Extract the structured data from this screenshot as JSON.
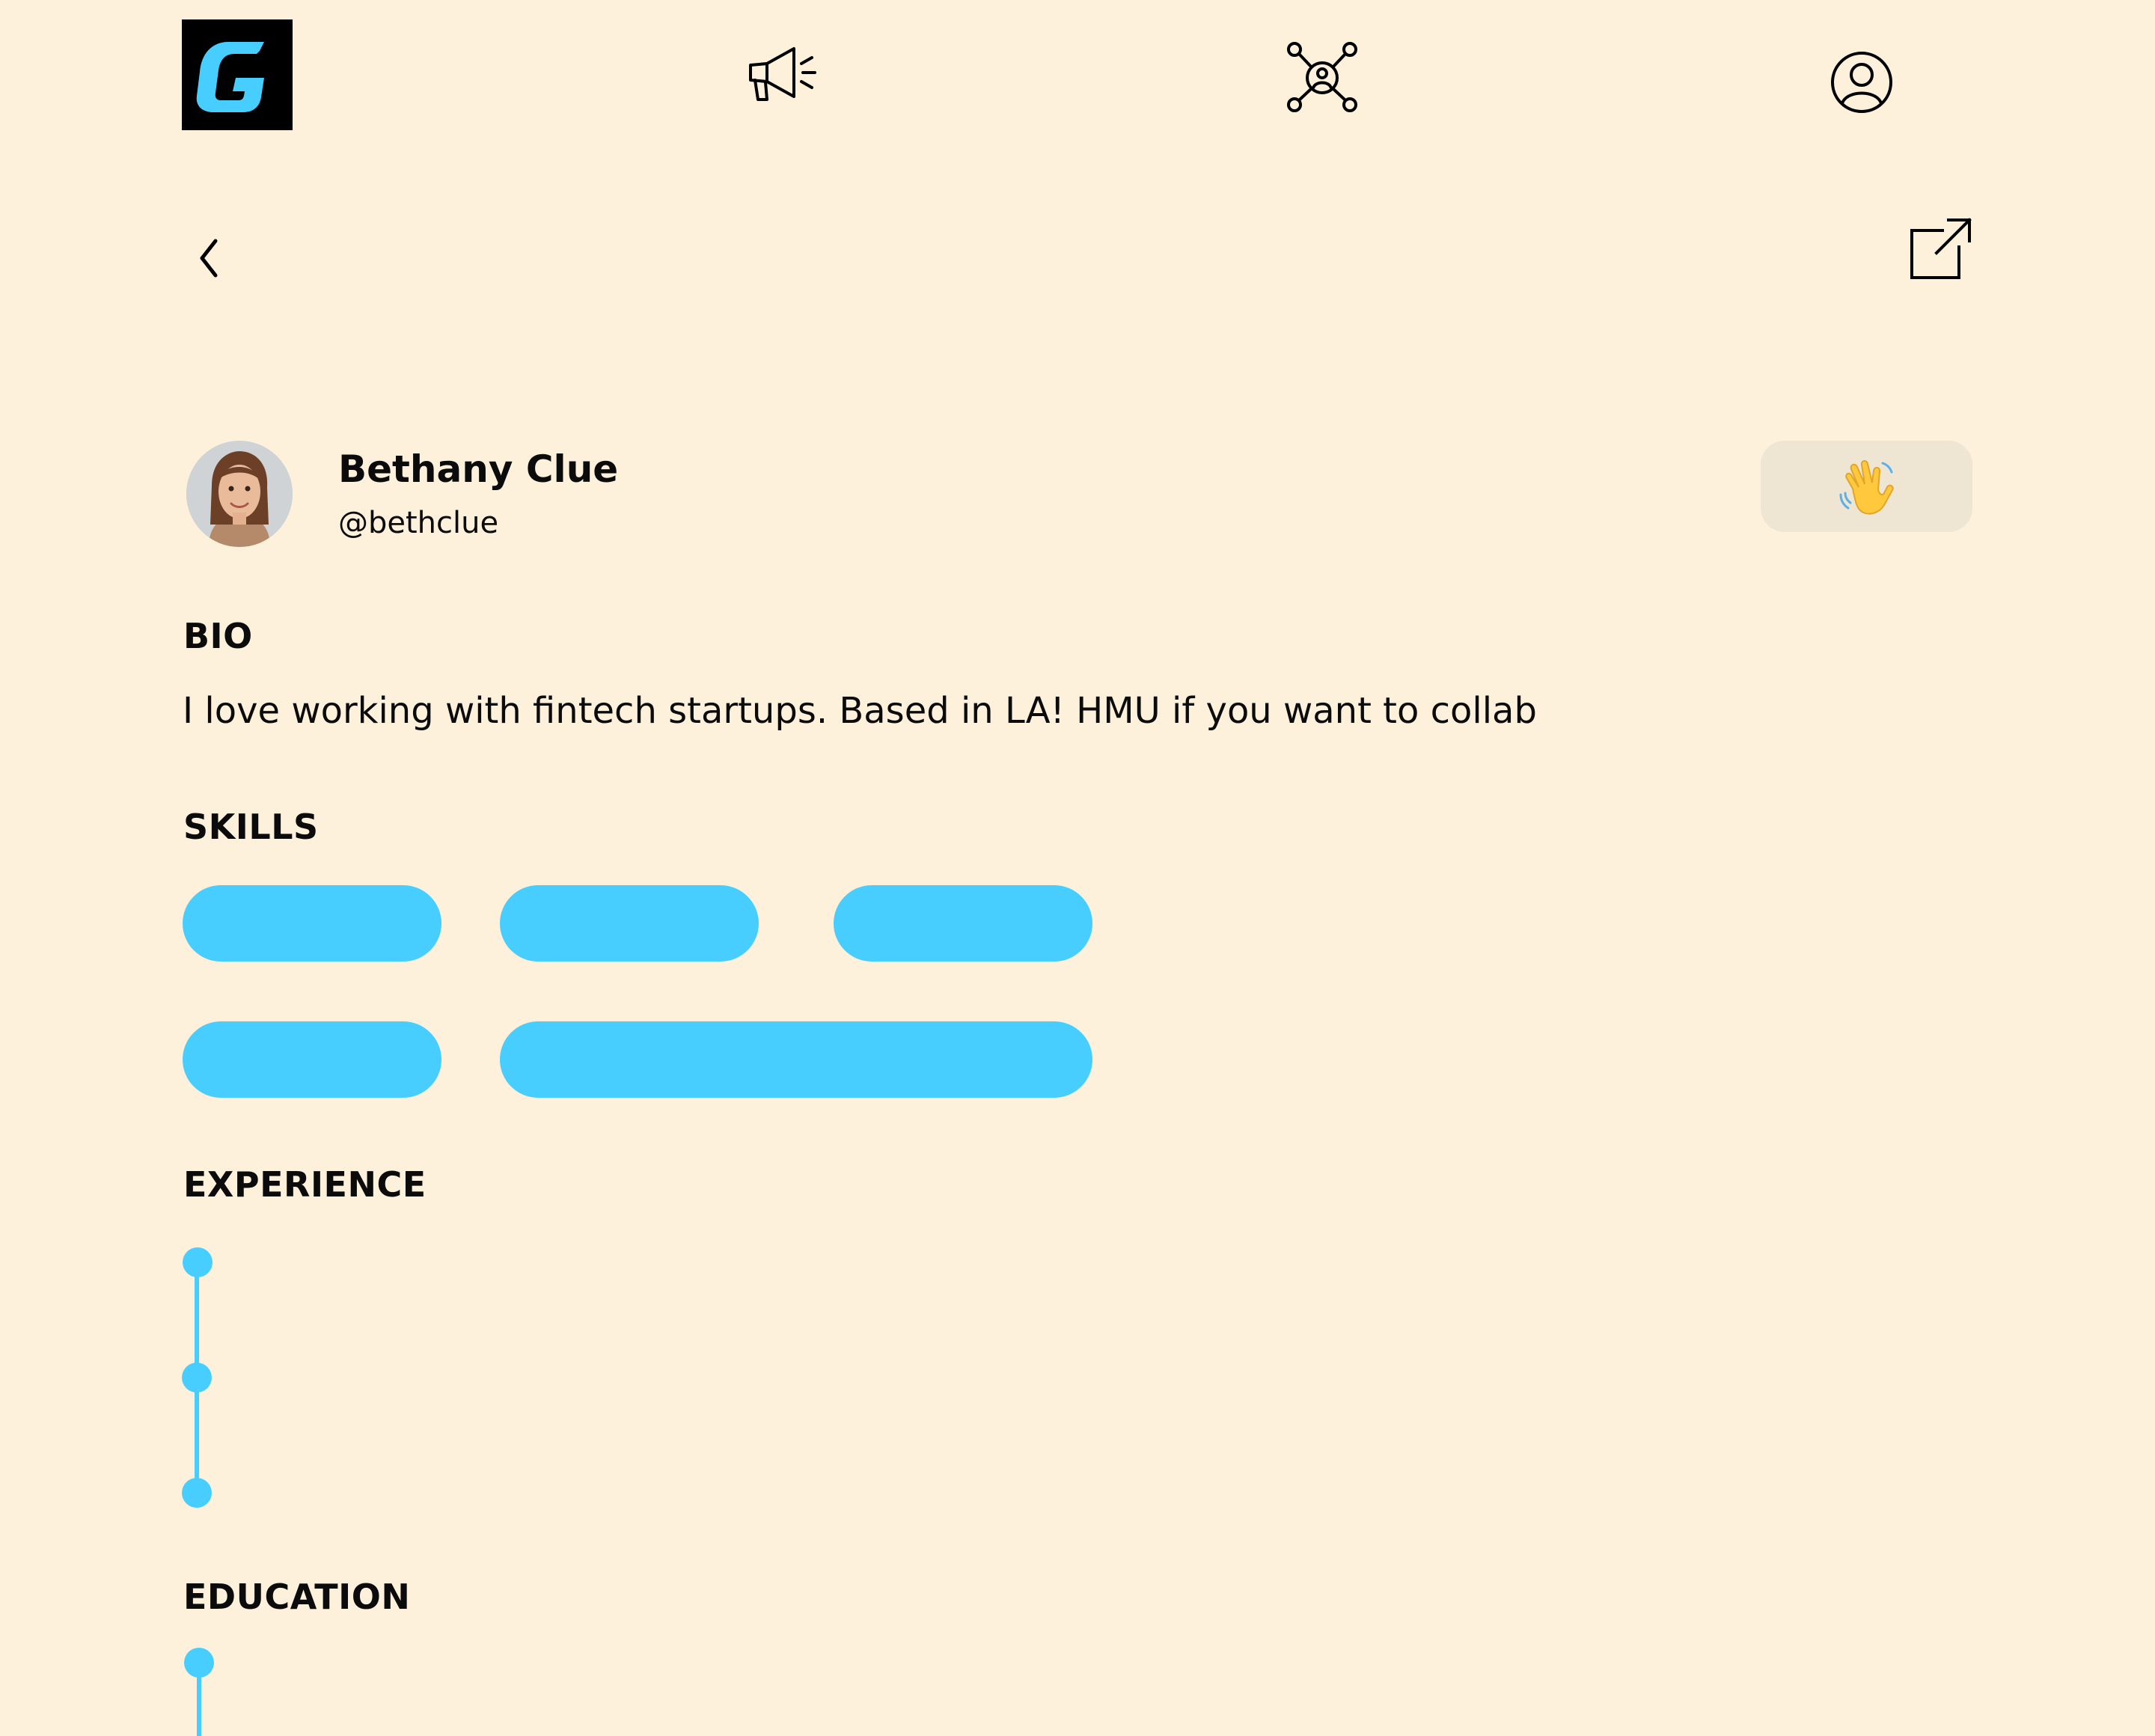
{
  "nav": {
    "logo_icon": "g-logo",
    "items": [
      {
        "icon": "megaphone-icon"
      },
      {
        "icon": "network-icon"
      },
      {
        "icon": "profile-icon"
      }
    ]
  },
  "toolbar": {
    "back_icon": "chevron-left-icon",
    "share_icon": "external-link-icon"
  },
  "profile": {
    "name": "Bethany Clue",
    "handle": "@bethclue",
    "wave_emoji": "👋"
  },
  "sections": {
    "bio_title": "BIO",
    "bio_text": "I love working with fintech startups. Based in LA! HMU if you want to collab",
    "skills_title": "SKILLS",
    "experience_title": "EXPERIENCE",
    "education_title": "EDUCATION"
  },
  "skills": {
    "count": 5
  },
  "colors": {
    "background": "#FDF1DC",
    "accent": "#47CEFF",
    "wave_button": "#EFE5D3",
    "logo_bg": "#000000"
  }
}
